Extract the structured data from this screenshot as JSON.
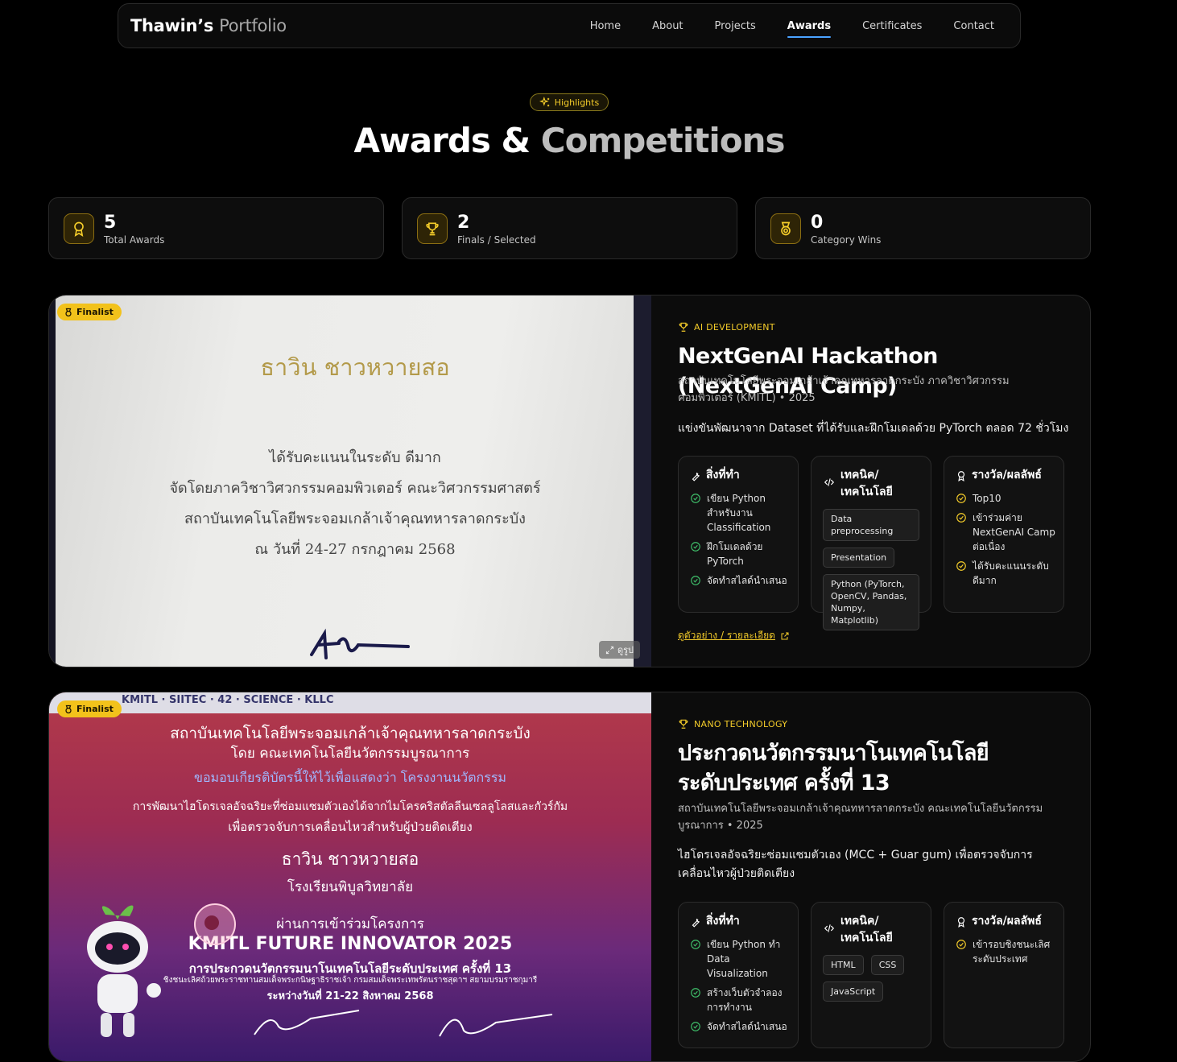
{
  "nav": {
    "brand_first": "Thawin’s",
    "brand_second": "Portfolio",
    "links": [
      "Home",
      "About",
      "Projects",
      "Awards",
      "Certificates",
      "Contact"
    ],
    "active": "Awards"
  },
  "header": {
    "pill": "Highlights",
    "title_first": "Awards &",
    "title_second": "Competitions"
  },
  "stats": [
    {
      "value": "5",
      "label": "Total Awards",
      "icon": "award-icon"
    },
    {
      "value": "2",
      "label": "Finals / Selected",
      "icon": "trophy-icon"
    },
    {
      "value": "0",
      "label": "Category Wins",
      "icon": "medal-icon"
    }
  ],
  "colors": {
    "accent": "#f2c21b",
    "nav_underline": "#4aa3ff"
  },
  "cards": [
    {
      "badge": "Finalist",
      "zoom_label": "ดูรูป",
      "category": "AI DEVELOPMENT",
      "title": "NextGenAI Hackathon (NextGenAI Camp)",
      "org": "สถาบันเทคโนโลยีพระจอมเกล้าเจ้าคุณทหารลาดกระบัง ภาควิชาวิศวกรรมคอมพิวเตอร์ (KMITL) • 2025",
      "desc": "แข่งขันพัฒนาจาก Dataset ที่ได้รับและฝึกโมเดลด้วย PyTorch ตลอด 72 ชั่วโมง",
      "did_head": "สิ่งที่ทำ",
      "did": [
        "เขียน Python สำหรับงาน Classification",
        "ฝึกโมเดลด้วย PyTorch",
        "จัดทำสไลด์นำเสนอ"
      ],
      "tech_head": "เทคนิค/เทคโนโลยี",
      "tech": [
        "Data preprocessing",
        "Presentation",
        "Python (PyTorch, OpenCV, Pandas, Numpy, Matplotlib)"
      ],
      "result_head": "รางวัล/ผลลัพธ์",
      "results": [
        "Top10",
        "เข้าร่วมค่าย NextGenAI Camp ต่อเนื่อง",
        "ได้รับคะแนนระดับ ดีมาก"
      ],
      "link": "ดูตัวอย่าง / รายละเอียด",
      "cert": {
        "name": "ธาวิน ชาวหวายสอ",
        "lines": [
          "ได้รับคะแนนในระดับ ดีมาก",
          "จัดโดยภาควิชาวิศวกรรมคอมพิวเตอร์ คณะวิศวกรรมศาสตร์",
          "สถาบันเทคโนโลยีพระจอมเกล้าเจ้าคุณทหารลาดกระบัง",
          "ณ วันที่ 24-27 กรกฎาคม 2568"
        ]
      }
    },
    {
      "badge": "Finalist",
      "category": "NANO TECHNOLOGY",
      "title": "ประกวดนวัตกรรมนาโนเทคโนโลยี ระดับประเทศ ครั้งที่ 13",
      "org": "สถาบันเทคโนโลยีพระจอมเกล้าเจ้าคุณทหารลาดกระบัง คณะเทคโนโลยีนวัตกรรมบูรณาการ • 2025",
      "desc": "ไฮโดรเจลอัจฉริยะซ่อมแซมตัวเอง (MCC + Guar gum) เพื่อตรวจจับการเคลื่อนไหวผู้ป่วยติดเตียง",
      "did_head": "สิ่งที่ทำ",
      "did": [
        "เขียน Python ทำ Data Visualization",
        "สร้างเว็บตัวจำลองการทำงาน",
        "จัดทำสไลด์นำเสนอ"
      ],
      "tech_head": "เทคนิค/เทคโนโลยี",
      "tech": [
        "HTML",
        "CSS",
        "JavaScript"
      ],
      "result_head": "รางวัล/ผลลัพธ์",
      "results": [
        "เข้ารอบชิงชนะเลิศระดับประเทศ"
      ],
      "cert": {
        "logos": "KMITL · SIITEC · 42 · SCIENCE · KLLC",
        "l1": "สถาบันเทคโนโลยีพระจอมเกล้าเจ้าคุณทหารลาดกระบัง",
        "l2": "โดย คณะเทคโนโลยีนวัตกรรมบูรณาการ",
        "l3": "ขอมอบเกียรติบัตรนี้ให้ไว้เพื่อแสดงว่า โครงงานนวัตกรรม",
        "l4": "การพัฒนาไฮโดรเจลอัจฉริยะที่ซ่อมแซมตัวเองได้จากไมโครคริสตัลลีนเซลลูโลสและกัวร์กัม",
        "l5": "เพื่อตรวจจับการเคลื่อนไหวสำหรับผู้ป่วยติดเตียง",
        "name": "ธาวิน ชาวหวายสอ",
        "school": "โรงเรียนพิบูลวิทยาลัย",
        "l6": "ผ่านการเข้าร่วมโครงการ",
        "event": "KMITL FUTURE INNOVATOR 2025",
        "l7": "การประกวดนวัตกรรมนาโนเทคโนโลยีระดับประเทศ ครั้งที่ 13",
        "l8": "ชิงชนะเลิศถ้วยพระราชทานสมเด็จพระกนิษฐาธิราชเจ้า กรมสมเด็จพระเทพรัตนราชสุดาฯ สยามบรมราชกุมารี",
        "date": "ระหว่างวันที่ 21-22 สิงหาคม 2568"
      }
    }
  ]
}
